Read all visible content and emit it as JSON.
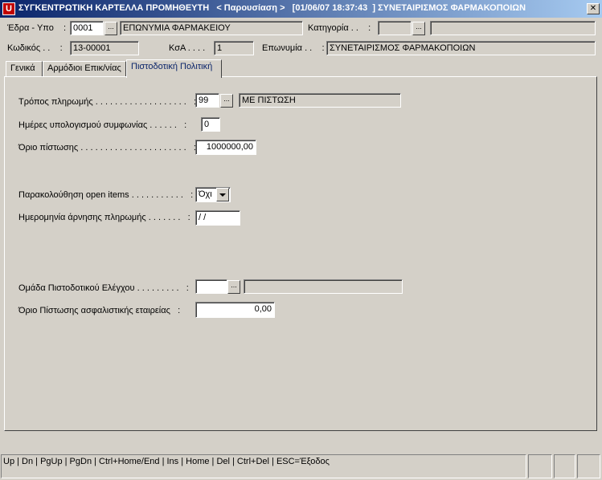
{
  "window": {
    "title": "ΣΥΓΚΕΝΤΡΩΤΙΚΗ ΚΑΡΤΕΛΛΑ ΠΡΟΜΗΘΕΥΤΗ   < Παρουσίαση >   [01/06/07 18:37:43  ] ΣΥΝΕΤΑΙΡΙΣΜΟΣ ΦΑΡΜΑΚΟΠΟΙΩΝ",
    "app_icon_glyph": "U",
    "accent": "#0a246a"
  },
  "header": {
    "edra_label": "Έδρα - Υπο    :",
    "edra_code": "0001",
    "edra_name": "ΕΠΩΝΥΜΙΑ ΦΑΡΜΑΚΕΙΟΥ",
    "kathgoria_label": "Κατηγορία . .    :",
    "kathgoria_code": "",
    "kathgoria_name": "",
    "kodikos_label": "Κωδικός . .    :",
    "kodikos_value": "13-00001",
    "ksa_label": "ΚσΑ . . . .    :",
    "ksa_value": "1",
    "eponymia_label": "Επωνυμία . .    :",
    "eponymia_value": "ΣΥΝΕΤΑΙΡΙΣΜΟΣ ΦΑΡΜΑΚΟΠΟΙΩΝ",
    "ellipsis": "..."
  },
  "tabs": [
    {
      "label": "Γενικά"
    },
    {
      "label": "Αρμόδιοι Επικ/νίας"
    },
    {
      "label": "Πιστοδοτική Πολιτική"
    }
  ],
  "form": {
    "payment_method_label": "Τρόπος πληρωμής . . . . . . . . . . . . . . . . . . .   :",
    "payment_method_code": "99",
    "payment_method_name": "ΜΕ ΠΙΣΤΩΣΗ",
    "agreement_days_label": "Ημέρες υπολογισμού συμφωνίας . . . . . .   :",
    "agreement_days_value": "0",
    "credit_limit_label": "Όριο πίστωσης . . . . . . . . . . . . . . . . . . . . . .   :",
    "credit_limit_value": "1000000,00",
    "open_items_label": "Παρακολούθηση open items . . . . . . . . . . .   :",
    "open_items_value": "Όχι",
    "payment_refusal_label": "Ημερομηνία άρνησης πληρωμής . . . . . . .   :",
    "payment_refusal_value": " /  /",
    "credit_group_label": "Ομάδα Πιστοδοτικού Ελέγχου . . . . . . . . .   :",
    "credit_group_code": "",
    "credit_group_name": "",
    "insurance_limit_label": "Όριο Πίστωσης ασφαλιστικής εταιρείας   :",
    "insurance_limit_value": "0,00"
  },
  "status": {
    "text": "Up | Dn | PgUp | PgDn | Ctrl+Home/End | Ins | Home | Del | Ctrl+Del  | ESC=Έξοδος"
  }
}
